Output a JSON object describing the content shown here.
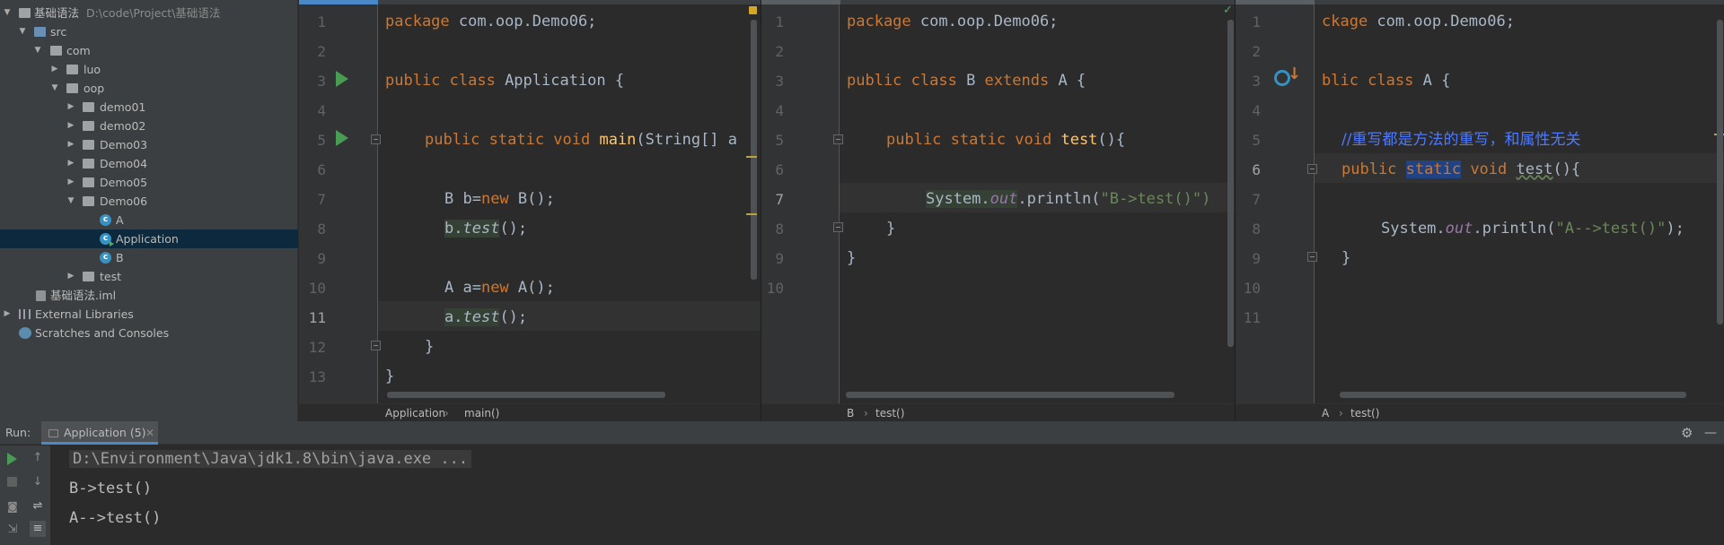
{
  "project": {
    "root_name": "基础语法",
    "root_path": "D:\\code\\Project\\基础语法",
    "items": [
      {
        "label": "src"
      },
      {
        "label": "com"
      },
      {
        "label": "luo"
      },
      {
        "label": "oop"
      },
      {
        "label": "demo01"
      },
      {
        "label": "demo02"
      },
      {
        "label": "Demo03"
      },
      {
        "label": "Demo04"
      },
      {
        "label": "Demo05"
      },
      {
        "label": "Demo06"
      },
      {
        "label": "A"
      },
      {
        "label": "Application"
      },
      {
        "label": "B"
      },
      {
        "label": "test"
      },
      {
        "label": "基础语法.iml"
      },
      {
        "label": "External Libraries"
      },
      {
        "label": "Scratches and Consoles"
      }
    ]
  },
  "editors": {
    "app": {
      "lines": [
        "1",
        "2",
        "3",
        "4",
        "5",
        "6",
        "7",
        "8",
        "9",
        "10",
        "11",
        "12",
        "13"
      ],
      "breadcrumb": [
        "Application",
        "main()"
      ],
      "code": {
        "l1_kw": "package ",
        "l1_rest": "com.oop.Demo06;",
        "l3_kw": "public class ",
        "l3_name": "Application",
        "l3_rest": " {",
        "l5_kw": "public static void ",
        "l5_name": "main",
        "l5_rest": "(String[] a",
        "l7_a": "B b=",
        "l7_kw": "new",
        "l7_b": " B();",
        "l8_a": "b.",
        "l8_m": "test",
        "l8_b": "();",
        "l10_a": "A a=",
        "l10_kw": "new",
        "l10_b": " A();",
        "l11_a": "a.",
        "l11_m": "test",
        "l11_b": "();",
        "l12": "}",
        "l13": "}"
      }
    },
    "b": {
      "lines": [
        "1",
        "2",
        "3",
        "4",
        "5",
        "6",
        "7",
        "8",
        "9",
        "10"
      ],
      "breadcrumb": [
        "B",
        "test()"
      ],
      "code": {
        "l1_kw": "package ",
        "l1_rest": "com.oop.Demo06;",
        "l3_kw": "public class ",
        "l3_name": "B",
        "l3_kw2": " extends ",
        "l3_rest": "A {",
        "l5_kw": "public static void ",
        "l5_name": "test",
        "l5_rest": "(){",
        "l7_a": "System.",
        "l7_out": "out",
        "l7_b": ".println(",
        "l7_str": "\"B->test()\")",
        "l8": "}",
        "l9": "}"
      }
    },
    "a": {
      "lines": [
        "1",
        "2",
        "3",
        "4",
        "5",
        "6",
        "7",
        "8",
        "9",
        "10",
        "11"
      ],
      "breadcrumb": [
        "A",
        "test()"
      ],
      "code": {
        "l1_kw": "ckage ",
        "l1_rest": "com.oop.Demo06;",
        "l3_kw": "blic class ",
        "l3_rest": "A {",
        "l5_comment": "//重写都是方法的重写，和属性无关",
        "l6_kw": "public ",
        "l6_static": "static",
        "l6_kw2": " void ",
        "l6_name": "test",
        "l6_rest": "(){",
        "l8_a": "System.",
        "l8_out": "out",
        "l8_b": ".println(",
        "l8_str": "\"A-->test()\"",
        "l8_c": ");",
        "l9": "}"
      }
    }
  },
  "run": {
    "label": "Run:",
    "tab": "Application (5)",
    "output": [
      "D:\\Environment\\Java\\jdk1.8\\bin\\java.exe ...",
      "B->test()",
      "A-->test()"
    ]
  },
  "colors": {
    "keyword": "#cc7832",
    "method": "#ffc66d",
    "string": "#6a8759",
    "field": "#9876aa",
    "comment": "#4d79ff",
    "selection": "#214283"
  }
}
